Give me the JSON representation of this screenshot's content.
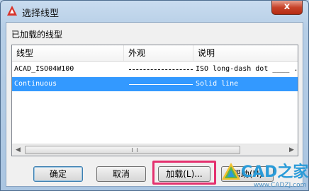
{
  "window": {
    "title": "选择线型",
    "close_glyph": "x"
  },
  "section_label": "已加载的线型",
  "columns": [
    "线型",
    "外观",
    "说明"
  ],
  "rows": [
    {
      "name": "ACAD_ISO04W100",
      "description": "ISO long-dash dot ____ . ____ .",
      "selected": false
    },
    {
      "name": "Continuous",
      "description": "Solid line",
      "selected": true
    }
  ],
  "buttons": {
    "ok": "确定",
    "cancel": "取消",
    "load": "加载(L)...",
    "help": "帮助(H)"
  },
  "watermark": {
    "text": "CAD之家",
    "url": "www.CADZJ.com"
  },
  "colors": {
    "selection": "#3399ff",
    "highlight": "#e4316f",
    "close": "#c7432a"
  }
}
